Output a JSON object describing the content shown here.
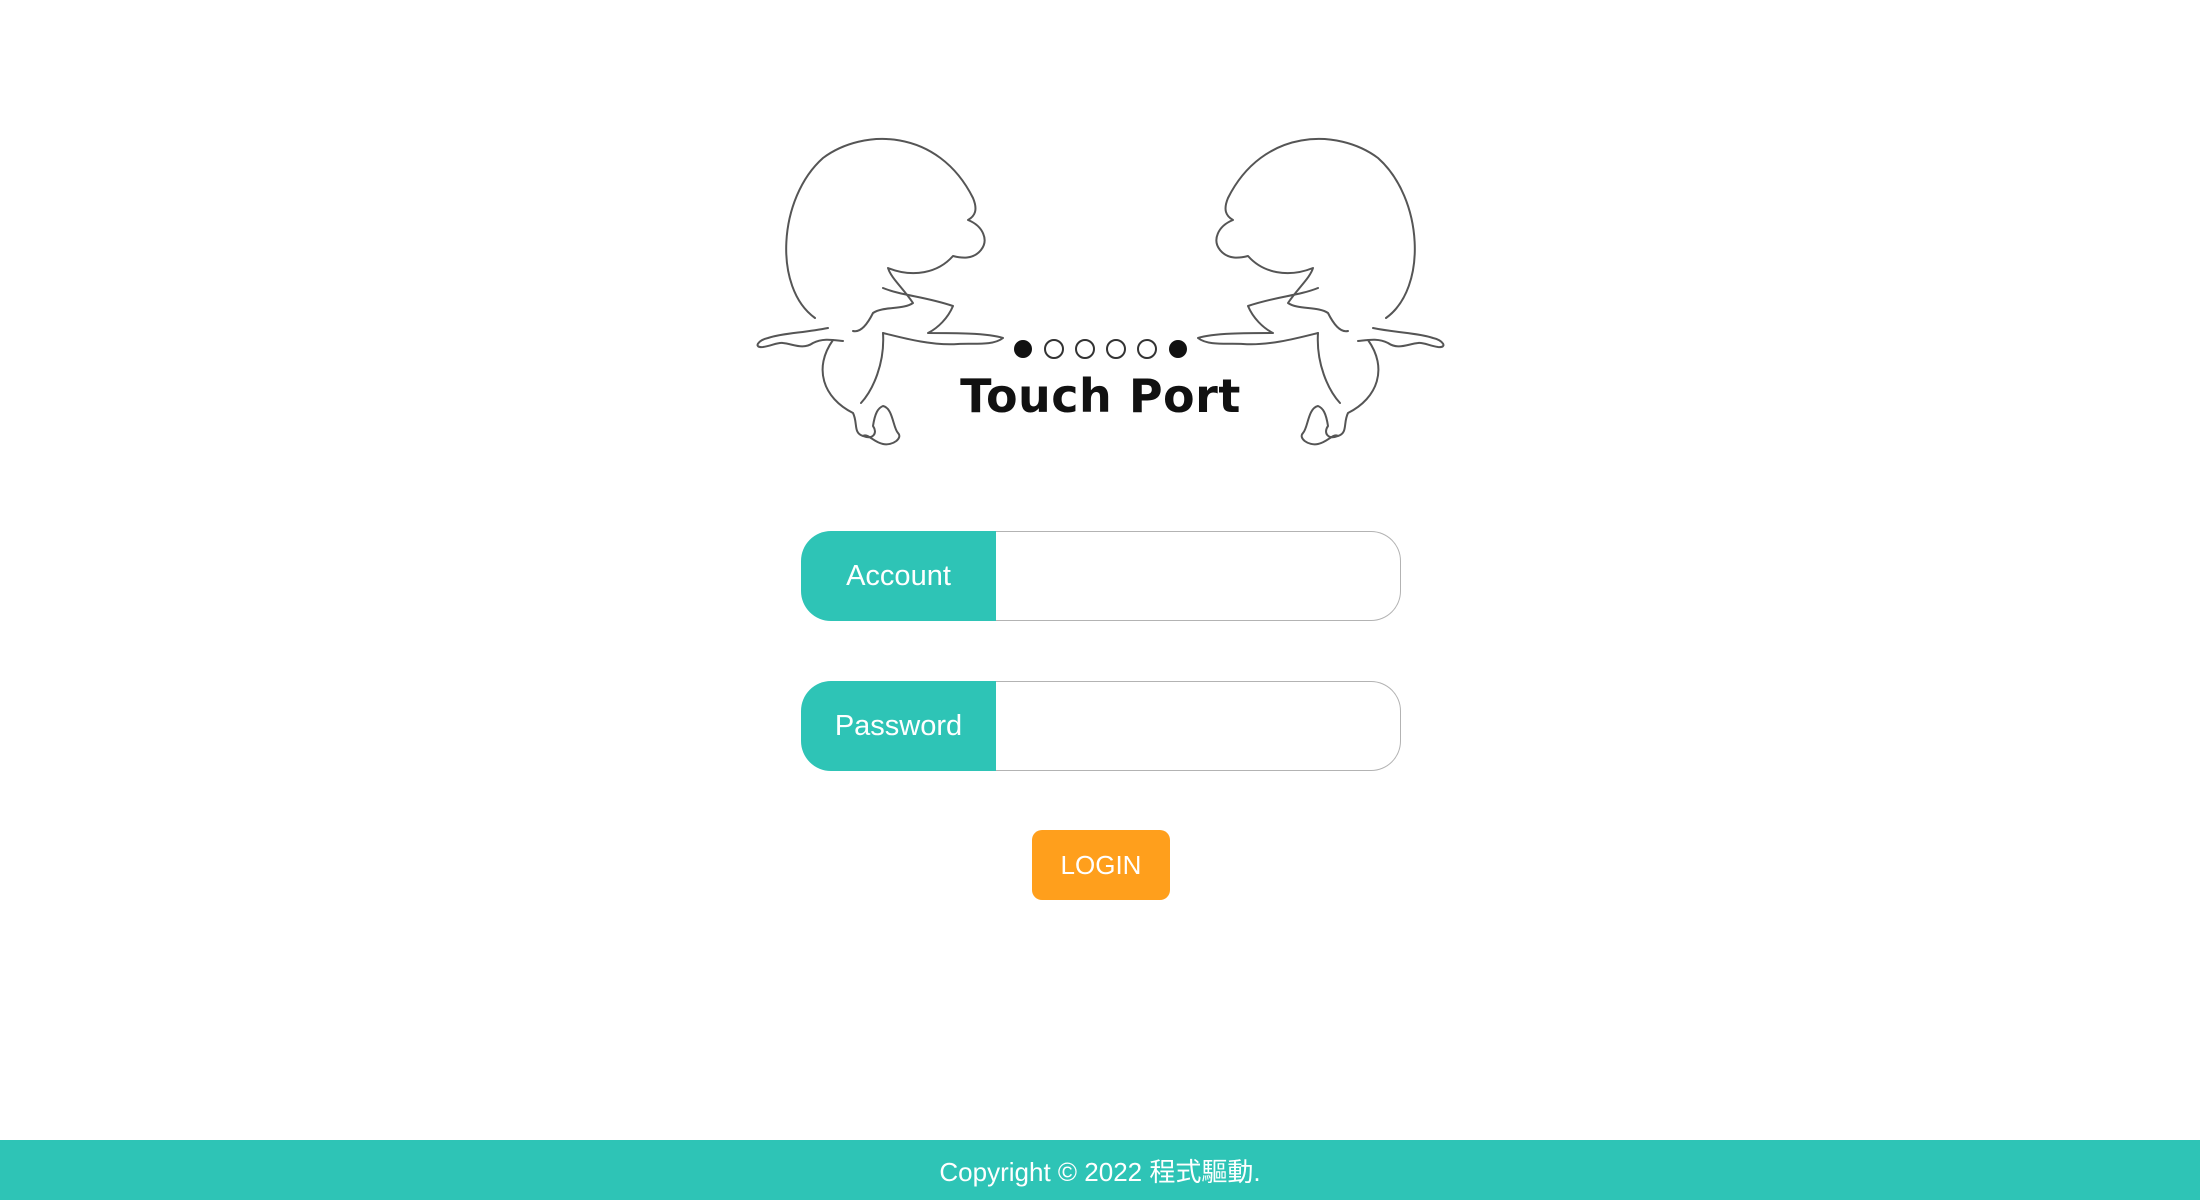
{
  "logo": {
    "title": "Touch Port",
    "dots_filled_ends": true,
    "dot_count": 6
  },
  "form": {
    "account": {
      "label": "Account",
      "value": "",
      "placeholder": ""
    },
    "password": {
      "label": "Password",
      "value": "",
      "placeholder": ""
    },
    "login_label": "LOGIN"
  },
  "footer": {
    "copyright": "Copyright © 2022 程式驅動."
  },
  "colors": {
    "primary": "#2ec4b6",
    "accent": "#ff9f1c",
    "background": "#ffffff"
  }
}
